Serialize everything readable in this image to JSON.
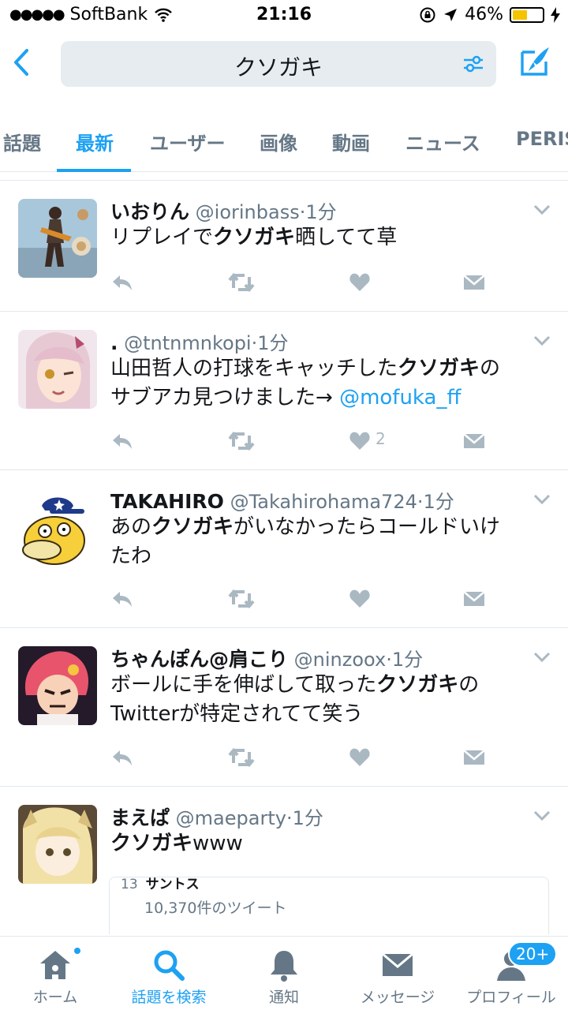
{
  "status_bar": {
    "carrier": "SoftBank",
    "time": "21:16",
    "battery": "46%"
  },
  "search": {
    "query": "クソガキ"
  },
  "tabs": [
    "話題",
    "最新",
    "ユーザー",
    "画像",
    "動画",
    "ニュース",
    "PERIS"
  ],
  "active_tab": "最新",
  "tweets": [
    {
      "name": "いおりん",
      "handle": "@iorinbass",
      "time": "1分",
      "text": [
        {
          "t": "リプレイで"
        },
        {
          "t": "クソガキ",
          "b": true
        },
        {
          "t": "晒してて草"
        }
      ],
      "likes": ""
    },
    {
      "name": ".",
      "handle": "@tntnmnkopi",
      "time": "1分",
      "text": [
        {
          "t": "山田哲人の打球をキャッチした"
        },
        {
          "t": "クソガキ",
          "b": true
        },
        {
          "t": "の"
        },
        {
          "t": "br"
        },
        {
          "t": "サブアカ見つけました→ "
        },
        {
          "t": "@mofuka_ff",
          "m": true
        }
      ],
      "likes": "2"
    },
    {
      "name": "TAKAHIRO",
      "handle": "@Takahirohama724",
      "time": "1分",
      "text": [
        {
          "t": "あの"
        },
        {
          "t": "クソガキ",
          "b": true
        },
        {
          "t": "がいなかったらコールドいけ"
        },
        {
          "t": "br"
        },
        {
          "t": "たわ"
        }
      ],
      "likes": ""
    },
    {
      "name": "ちゃんぽん@肩こり",
      "handle": "@ninzoox",
      "time": "1分",
      "text": [
        {
          "t": "ボールに手を伸ばして取った"
        },
        {
          "t": "クソガキ",
          "b": true
        },
        {
          "t": "の"
        },
        {
          "t": "br"
        },
        {
          "t": "Twitterが特定されてて笑う"
        }
      ],
      "likes": ""
    },
    {
      "name": "まえぱ",
      "handle": "@maeparty",
      "time": "1分",
      "text": [
        {
          "t": "クソガキ",
          "b": true
        },
        {
          "t": "www"
        }
      ],
      "likes": ""
    }
  ],
  "trend_card": {
    "rank": "13",
    "title": "サントス",
    "count": "10,370件のツイート"
  },
  "bottom_nav": [
    {
      "label": "ホーム",
      "icon": "home-icon"
    },
    {
      "label": "話題を検索",
      "icon": "search-icon"
    },
    {
      "label": "通知",
      "icon": "bell-icon"
    },
    {
      "label": "メッセージ",
      "icon": "mail-icon"
    },
    {
      "label": "プロフィール",
      "icon": "profile-icon"
    }
  ],
  "profile_badge": "20+",
  "colors": {
    "accent": "#1da1f2",
    "muted": "#657786",
    "icon": "#aab8c2"
  }
}
